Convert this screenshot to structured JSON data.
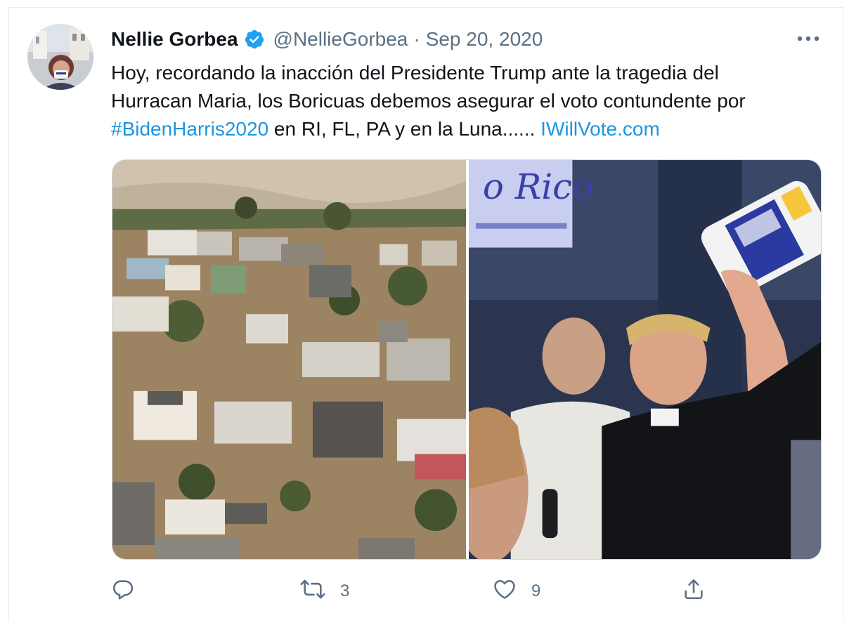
{
  "tweet": {
    "author_name": "Nellie Gorbea",
    "handle": "@NellieGorbea",
    "separator": "·",
    "date": "Sep 20, 2020",
    "text_line1": "Hoy, recordando la inacción del Presidente Trump ante la tragedia del",
    "text_line2": "Hurracan Maria, los Boricuas debemos asegurar el voto contundente por",
    "hashtag": "#BidenHarris2020",
    "text_line3_middle": " en RI, FL, PA y en la Luna...... ",
    "link": "IWillVote.com",
    "images": [
      {
        "alt_icon": "flooded-neighborhood-photo"
      },
      {
        "alt_icon": "paper-towel-toss-photo"
      }
    ]
  },
  "actions": {
    "reply_count": "",
    "retweet_count": "3",
    "like_count": "9"
  },
  "colors": {
    "link": "#1b95e0",
    "muted": "#5b7083",
    "verified": "#1da1f2",
    "border": "#e6ecf0"
  },
  "icons": [
    "verified-badge-icon",
    "more-icon",
    "reply-icon",
    "retweet-icon",
    "like-icon",
    "share-icon"
  ]
}
